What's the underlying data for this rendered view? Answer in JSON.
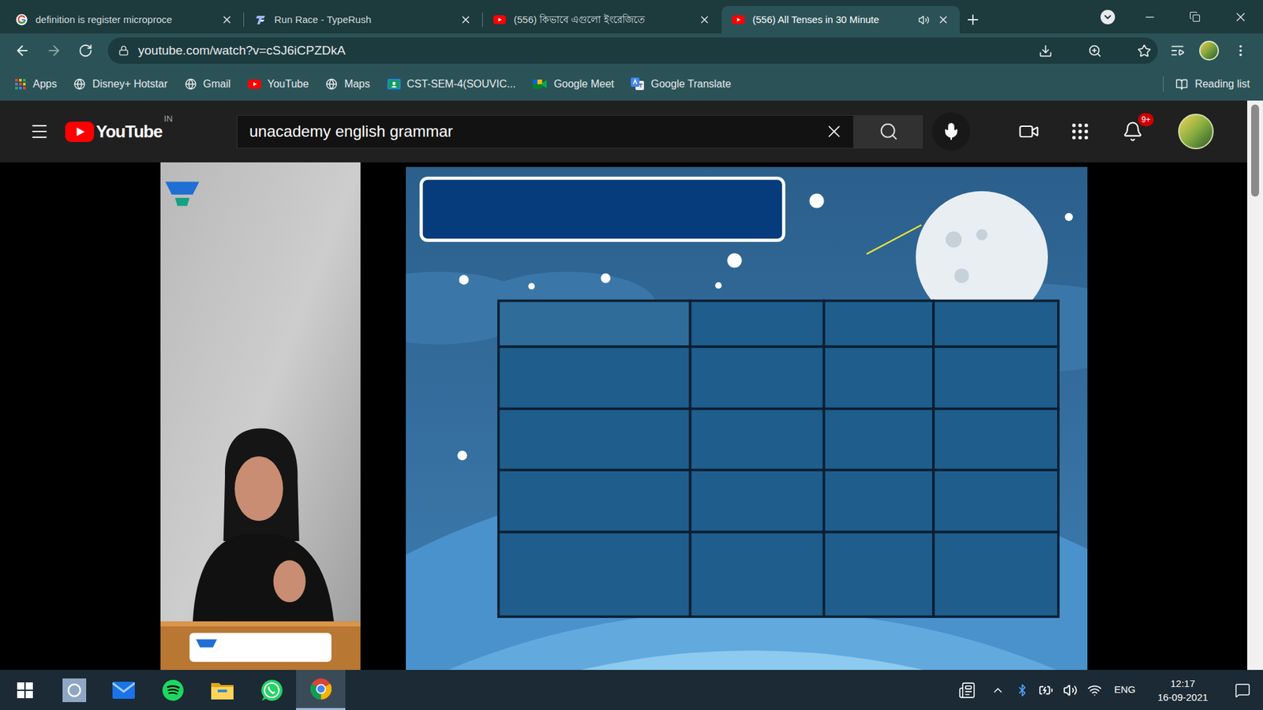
{
  "browser": {
    "tabs": [
      {
        "title": "definition is register microproce",
        "kind": "google",
        "selected": false,
        "audio": false
      },
      {
        "title": "Run Race - TypeRush",
        "kind": "typerush",
        "selected": false,
        "audio": false
      },
      {
        "title": "(556) কিভাবে এগুলো ইংরেজিতে",
        "kind": "youtube",
        "selected": false,
        "audio": false
      },
      {
        "title": "(556) All Tenses in 30 Minute",
        "kind": "youtube",
        "selected": true,
        "audio": true
      }
    ],
    "address": "youtube.com/watch?v=cSJ6iCPZDkA",
    "bookmarks": [
      {
        "label": "Apps",
        "kind": "apps"
      },
      {
        "label": "Disney+ Hotstar",
        "kind": "globe"
      },
      {
        "label": "Gmail",
        "kind": "globe"
      },
      {
        "label": "YouTube",
        "kind": "youtube"
      },
      {
        "label": "Maps",
        "kind": "globe"
      },
      {
        "label": "CST-SEM-4(SOUVIC...",
        "kind": "classroom"
      },
      {
        "label": "Google Meet",
        "kind": "meet"
      },
      {
        "label": "Google Translate",
        "kind": "translate"
      }
    ],
    "reading_list": "Reading list"
  },
  "youtube": {
    "logo": "YouTube",
    "region": "IN",
    "search": "unacademy english grammar",
    "notifications": "9+"
  },
  "taskbar": {
    "apps": [
      {
        "kind": "windows",
        "selected": false
      },
      {
        "kind": "cortana",
        "selected": false
      },
      {
        "kind": "mail",
        "selected": false
      },
      {
        "kind": "spotify",
        "selected": false
      },
      {
        "kind": "explorer",
        "selected": false
      },
      {
        "kind": "whatsapp",
        "selected": false
      },
      {
        "kind": "chrome",
        "selected": true
      }
    ],
    "tray": {
      "language": "ENG",
      "time": "12:17",
      "date": "16-09-2021"
    }
  }
}
